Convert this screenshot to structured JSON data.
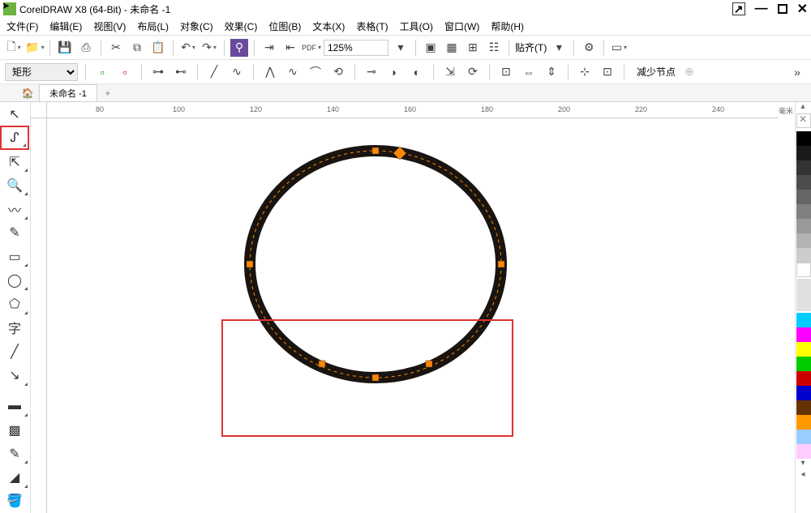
{
  "app": {
    "title": "CorelDRAW X8 (64-Bit) - 未命名 -1"
  },
  "menu": {
    "file": "文件(F)",
    "edit": "编辑(E)",
    "view": "视图(V)",
    "layout": "布局(L)",
    "object": "对象(C)",
    "effect": "效果(C)",
    "bitmap": "位图(B)",
    "text": "文本(X)",
    "table": "表格(T)",
    "tool": "工具(O)",
    "window": "窗口(W)",
    "help": "帮助(H)"
  },
  "toolbar": {
    "zoom": "125%",
    "snap": "贴齐(T)",
    "shape_mode": "矩形",
    "reduce_nodes": "减少节点"
  },
  "tabs": {
    "doc1": "未命名 -1"
  },
  "ruler": {
    "unit": "毫米",
    "marks": [
      "80",
      "100",
      "120",
      "140",
      "160",
      "180",
      "200",
      "220",
      "240"
    ]
  },
  "palette": {
    "colors": [
      "#000000",
      "#404040",
      "#808080",
      "#c0c0c0",
      "#ffffff",
      "#400000",
      "#800000",
      "#ff0000",
      "#ff8000",
      "#ffff00",
      "#80ff00",
      "#00ff00",
      "#008000",
      "#00ffff",
      "#0080ff",
      "#0000ff",
      "#000080",
      "#8000ff",
      "#ff00ff",
      "#ff0080",
      "#804000",
      "#c08040"
    ]
  }
}
